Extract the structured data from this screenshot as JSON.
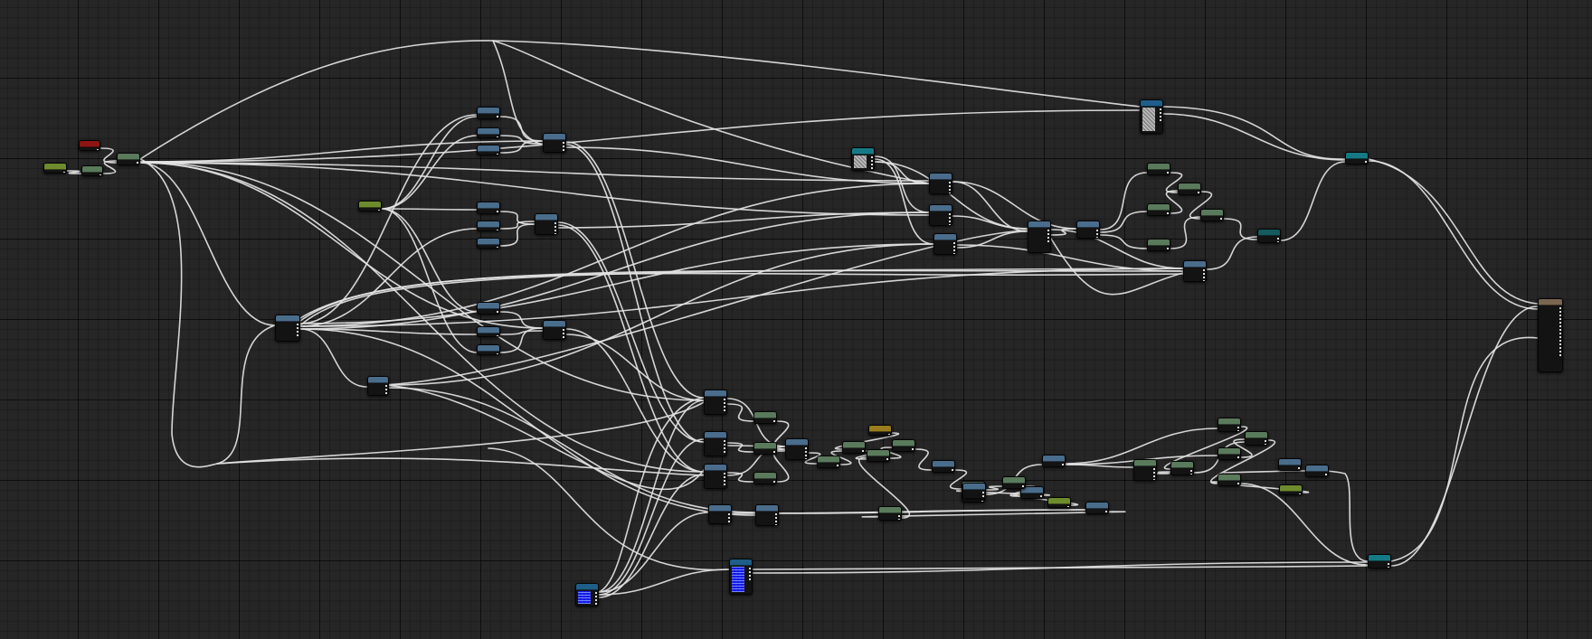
{
  "colors": {
    "background": "#262626",
    "wire": "#e4e4e4",
    "node_body": "#131313",
    "header_blue": "#4a6d8c",
    "header_green": "#5a7a5c",
    "header_lime": "#6e8c2e",
    "header_red": "#8e1414",
    "header_teal": "#167a86",
    "header_gold": "#9a7d1c",
    "header_tan": "#7a6650",
    "header_darkteal": "#145a5e",
    "header_deepblue": "#1f5e88"
  },
  "graph": {
    "nodes": [
      {
        "id": "n_in_lime",
        "type": "lime",
        "kind": "parameter",
        "icon": "parameter-node-icon"
      },
      {
        "id": "n_in_red",
        "type": "red",
        "kind": "parameter",
        "icon": "parameter-node-icon"
      },
      {
        "id": "n_in_green2",
        "type": "green",
        "kind": "math",
        "icon": "math-node-icon"
      },
      {
        "id": "n_split",
        "type": "green",
        "kind": "math",
        "icon": "math-node-icon"
      },
      {
        "id": "n_lime2",
        "type": "lime",
        "kind": "parameter",
        "icon": "parameter-node-icon"
      },
      {
        "id": "b1",
        "type": "blue",
        "kind": "math",
        "icon": "math-node-icon"
      },
      {
        "id": "b2",
        "type": "blue",
        "kind": "math",
        "icon": "math-node-icon"
      },
      {
        "id": "b3",
        "type": "blue",
        "kind": "math",
        "icon": "math-node-icon"
      },
      {
        "id": "b4",
        "type": "blue",
        "kind": "math",
        "icon": "math-node-icon"
      },
      {
        "id": "b5",
        "type": "blue",
        "kind": "math",
        "icon": "math-node-icon"
      },
      {
        "id": "b6",
        "type": "blue",
        "kind": "math",
        "icon": "math-node-icon"
      },
      {
        "id": "b7",
        "type": "blue",
        "kind": "math",
        "icon": "math-node-icon"
      },
      {
        "id": "b8",
        "type": "blue",
        "kind": "math",
        "icon": "math-node-icon"
      },
      {
        "id": "b9",
        "type": "blue",
        "kind": "math",
        "icon": "math-node-icon"
      },
      {
        "id": "m1",
        "type": "blue",
        "kind": "math",
        "icon": "math-node-icon"
      },
      {
        "id": "m2",
        "type": "blue",
        "kind": "math",
        "icon": "math-node-icon"
      },
      {
        "id": "m3",
        "type": "blue",
        "kind": "math",
        "icon": "math-node-icon"
      },
      {
        "id": "hub",
        "type": "blue",
        "kind": "math",
        "icon": "math-node-icon"
      },
      {
        "id": "hub2",
        "type": "blue",
        "kind": "math",
        "icon": "math-node-icon"
      },
      {
        "id": "tex_noise",
        "type": "teal",
        "kind": "texture",
        "icon": "texture-node-icon"
      },
      {
        "id": "tex_top",
        "type": "deepblue",
        "kind": "texture",
        "icon": "texture-node-icon"
      },
      {
        "id": "c1",
        "type": "blue",
        "kind": "math",
        "icon": "math-node-icon"
      },
      {
        "id": "c2",
        "type": "blue",
        "kind": "math",
        "icon": "math-node-icon"
      },
      {
        "id": "c3",
        "type": "blue",
        "kind": "math",
        "icon": "math-node-icon"
      },
      {
        "id": "d1",
        "type": "blue",
        "kind": "math",
        "icon": "math-node-icon"
      },
      {
        "id": "d2",
        "type": "blue",
        "kind": "math",
        "icon": "math-node-icon"
      },
      {
        "id": "g1",
        "type": "green",
        "kind": "math",
        "icon": "math-node-icon"
      },
      {
        "id": "g2",
        "type": "green",
        "kind": "math",
        "icon": "math-node-icon"
      },
      {
        "id": "g3",
        "type": "green",
        "kind": "math",
        "icon": "math-node-icon"
      },
      {
        "id": "g4",
        "type": "green",
        "kind": "math",
        "icon": "math-node-icon"
      },
      {
        "id": "g5",
        "type": "green",
        "kind": "math",
        "icon": "math-node-icon"
      },
      {
        "id": "e1",
        "type": "blue",
        "kind": "math",
        "icon": "math-node-icon"
      },
      {
        "id": "t_lerp",
        "type": "darkteal",
        "kind": "math",
        "icon": "math-node-icon"
      },
      {
        "id": "t_top",
        "type": "teal",
        "kind": "math",
        "icon": "math-node-icon"
      },
      {
        "id": "out",
        "type": "tan",
        "kind": "output",
        "icon": "material-output-icon"
      },
      {
        "id": "t_bot",
        "type": "teal",
        "kind": "math",
        "icon": "math-node-icon"
      },
      {
        "id": "l1",
        "type": "blue",
        "kind": "math",
        "icon": "math-node-icon"
      },
      {
        "id": "l2",
        "type": "blue",
        "kind": "math",
        "icon": "math-node-icon"
      },
      {
        "id": "l3",
        "type": "blue",
        "kind": "math",
        "icon": "math-node-icon"
      },
      {
        "id": "l4",
        "type": "blue",
        "kind": "math",
        "icon": "math-node-icon"
      },
      {
        "id": "l5",
        "type": "blue",
        "kind": "math",
        "icon": "math-node-icon"
      },
      {
        "id": "lg1",
        "type": "green",
        "kind": "math",
        "icon": "math-node-icon"
      },
      {
        "id": "lg2",
        "type": "green",
        "kind": "math",
        "icon": "math-node-icon"
      },
      {
        "id": "lg3",
        "type": "green",
        "kind": "math",
        "icon": "math-node-icon"
      },
      {
        "id": "lb1",
        "type": "blue",
        "kind": "math",
        "icon": "math-node-icon"
      },
      {
        "id": "lg4",
        "type": "green",
        "kind": "math",
        "icon": "math-node-icon"
      },
      {
        "id": "lgold",
        "type": "gold",
        "kind": "parameter",
        "icon": "parameter-node-icon"
      },
      {
        "id": "lg5",
        "type": "green",
        "kind": "math",
        "icon": "math-node-icon"
      },
      {
        "id": "lg6",
        "type": "green",
        "kind": "math",
        "icon": "math-node-icon"
      },
      {
        "id": "lb2",
        "type": "blue",
        "kind": "math",
        "icon": "math-node-icon"
      },
      {
        "id": "lg7",
        "type": "green",
        "kind": "math",
        "icon": "math-node-icon"
      },
      {
        "id": "lg8",
        "type": "green",
        "kind": "math",
        "icon": "math-node-icon"
      },
      {
        "id": "llime",
        "type": "lime",
        "kind": "parameter",
        "icon": "parameter-node-icon"
      },
      {
        "id": "lb3",
        "type": "blue",
        "kind": "math",
        "icon": "math-node-icon"
      },
      {
        "id": "lg9",
        "type": "green",
        "kind": "math",
        "icon": "math-node-icon"
      },
      {
        "id": "lb4",
        "type": "blue",
        "kind": "math",
        "icon": "math-node-icon"
      },
      {
        "id": "lb5",
        "type": "blue",
        "kind": "math",
        "icon": "math-node-icon"
      },
      {
        "id": "lb6",
        "type": "blue",
        "kind": "math",
        "icon": "math-node-icon"
      },
      {
        "id": "rg1",
        "type": "green",
        "kind": "math",
        "icon": "math-node-icon"
      },
      {
        "id": "rg2",
        "type": "green",
        "kind": "math",
        "icon": "math-node-icon"
      },
      {
        "id": "rg3",
        "type": "green",
        "kind": "math",
        "icon": "math-node-icon"
      },
      {
        "id": "rg4",
        "type": "green",
        "kind": "math",
        "icon": "math-node-icon"
      },
      {
        "id": "rg5",
        "type": "green",
        "kind": "math",
        "icon": "math-node-icon"
      },
      {
        "id": "rg6",
        "type": "green",
        "kind": "math",
        "icon": "math-node-icon"
      },
      {
        "id": "rlime",
        "type": "lime",
        "kind": "parameter",
        "icon": "parameter-node-icon"
      },
      {
        "id": "lb7",
        "type": "blue",
        "kind": "math",
        "icon": "math-node-icon"
      },
      {
        "id": "lb8",
        "type": "blue",
        "kind": "math",
        "icon": "math-node-icon"
      },
      {
        "id": "lg10",
        "type": "green",
        "kind": "math",
        "icon": "math-node-icon"
      },
      {
        "id": "tex_blue1",
        "type": "deepblue",
        "kind": "texture",
        "icon": "texture-node-icon"
      },
      {
        "id": "tex_blue2",
        "type": "deepblue",
        "kind": "texture",
        "icon": "texture-node-icon"
      }
    ],
    "wires": [
      [
        "n_in_lime",
        "n_in_green2"
      ],
      [
        "n_in_red",
        "n_split"
      ],
      [
        "n_in_green2",
        "n_split"
      ],
      [
        "n_split",
        "tex_top"
      ],
      [
        "n_split",
        "c1"
      ],
      [
        "n_split",
        "c2"
      ],
      [
        "n_split",
        "m1"
      ],
      [
        "n_split",
        "hub"
      ],
      [
        "n_split",
        "m3"
      ],
      [
        "n_lime2",
        "b1"
      ],
      [
        "n_lime2",
        "b4"
      ],
      [
        "n_lime2",
        "b7"
      ],
      [
        "n_lime2",
        "b2"
      ],
      [
        "n_lime2",
        "b9"
      ],
      [
        "b1",
        "m1"
      ],
      [
        "b2",
        "m1"
      ],
      [
        "b3",
        "m1"
      ],
      [
        "b4",
        "m2"
      ],
      [
        "b5",
        "m2"
      ],
      [
        "b6",
        "m2"
      ],
      [
        "b7",
        "m3"
      ],
      [
        "b8",
        "m3"
      ],
      [
        "b9",
        "m3"
      ],
      [
        "m1",
        "c1"
      ],
      [
        "m1",
        "l1"
      ],
      [
        "m1",
        "l2"
      ],
      [
        "m2",
        "c2"
      ],
      [
        "m2",
        "l2"
      ],
      [
        "m2",
        "l3"
      ],
      [
        "m3",
        "l1"
      ],
      [
        "m3",
        "l3"
      ],
      [
        "hub",
        "c1"
      ],
      [
        "hub",
        "c2"
      ],
      [
        "hub",
        "c3"
      ],
      [
        "hub",
        "e1"
      ],
      [
        "hub",
        "hub2"
      ],
      [
        "hub",
        "b1"
      ],
      [
        "hub",
        "b5"
      ],
      [
        "hub",
        "b8"
      ],
      [
        "hub2",
        "c3"
      ],
      [
        "hub2",
        "l5"
      ],
      [
        "tex_noise",
        "c1"
      ],
      [
        "tex_noise",
        "c2"
      ],
      [
        "tex_noise",
        "c3"
      ],
      [
        "tex_noise",
        "d1"
      ],
      [
        "c1",
        "d1"
      ],
      [
        "c2",
        "d1"
      ],
      [
        "c3",
        "d1"
      ],
      [
        "c1",
        "d2"
      ],
      [
        "c3",
        "e1"
      ],
      [
        "d1",
        "d2"
      ],
      [
        "d2",
        "g1"
      ],
      [
        "d2",
        "g3"
      ],
      [
        "d2",
        "g5"
      ],
      [
        "d1",
        "e1"
      ],
      [
        "g1",
        "g2"
      ],
      [
        "g3",
        "g2"
      ],
      [
        "g2",
        "g4"
      ],
      [
        "g5",
        "g4"
      ],
      [
        "g4",
        "t_lerp"
      ],
      [
        "e1",
        "t_lerp"
      ],
      [
        "t_lerp",
        "t_top"
      ],
      [
        "tex_top",
        "t_top"
      ],
      [
        "t_top",
        "out"
      ],
      [
        "t_bot",
        "out"
      ],
      [
        "l1",
        "lg1"
      ],
      [
        "l1",
        "lb1"
      ],
      [
        "l2",
        "lg2"
      ],
      [
        "l2",
        "lb1"
      ],
      [
        "l3",
        "lg3"
      ],
      [
        "l3",
        "lb1"
      ],
      [
        "lg1",
        "lb1"
      ],
      [
        "lg2",
        "lb1"
      ],
      [
        "lg3",
        "lb1"
      ],
      [
        "lb1",
        "lg4"
      ],
      [
        "lg4",
        "lg5"
      ],
      [
        "lgold",
        "lg5"
      ],
      [
        "lg5",
        "lg6"
      ],
      [
        "lg6",
        "lg7"
      ],
      [
        "lg7",
        "lb2"
      ],
      [
        "lb2",
        "lg8"
      ],
      [
        "lg8",
        "lg9"
      ],
      [
        "llime",
        "lb3"
      ],
      [
        "lg9",
        "lb3"
      ],
      [
        "lb3",
        "lb4"
      ],
      [
        "lb4",
        "lb5"
      ],
      [
        "lb5",
        "rg1"
      ],
      [
        "lb5",
        "rg3"
      ],
      [
        "lb5",
        "rg5"
      ],
      [
        "rg1",
        "rg2"
      ],
      [
        "rg3",
        "rg2"
      ],
      [
        "rg2",
        "rg4"
      ],
      [
        "rg5",
        "rg4"
      ],
      [
        "rg4",
        "rg6"
      ],
      [
        "rlime",
        "rg6"
      ],
      [
        "rg6",
        "t_bot"
      ],
      [
        "l4",
        "lb6"
      ],
      [
        "lb6",
        "lg10"
      ],
      [
        "lg10",
        "lg6"
      ],
      [
        "tex_blue1",
        "l1"
      ],
      [
        "tex_blue1",
        "l2"
      ],
      [
        "tex_blue1",
        "l3"
      ],
      [
        "tex_blue1",
        "l4"
      ],
      [
        "tex_blue1",
        "tex_blue2"
      ],
      [
        "tex_blue2",
        "t_bot"
      ],
      [
        "n_split",
        "l1"
      ],
      [
        "n_split",
        "l3"
      ],
      [
        "hub",
        "l5"
      ],
      [
        "l5",
        "lb6"
      ]
    ]
  }
}
